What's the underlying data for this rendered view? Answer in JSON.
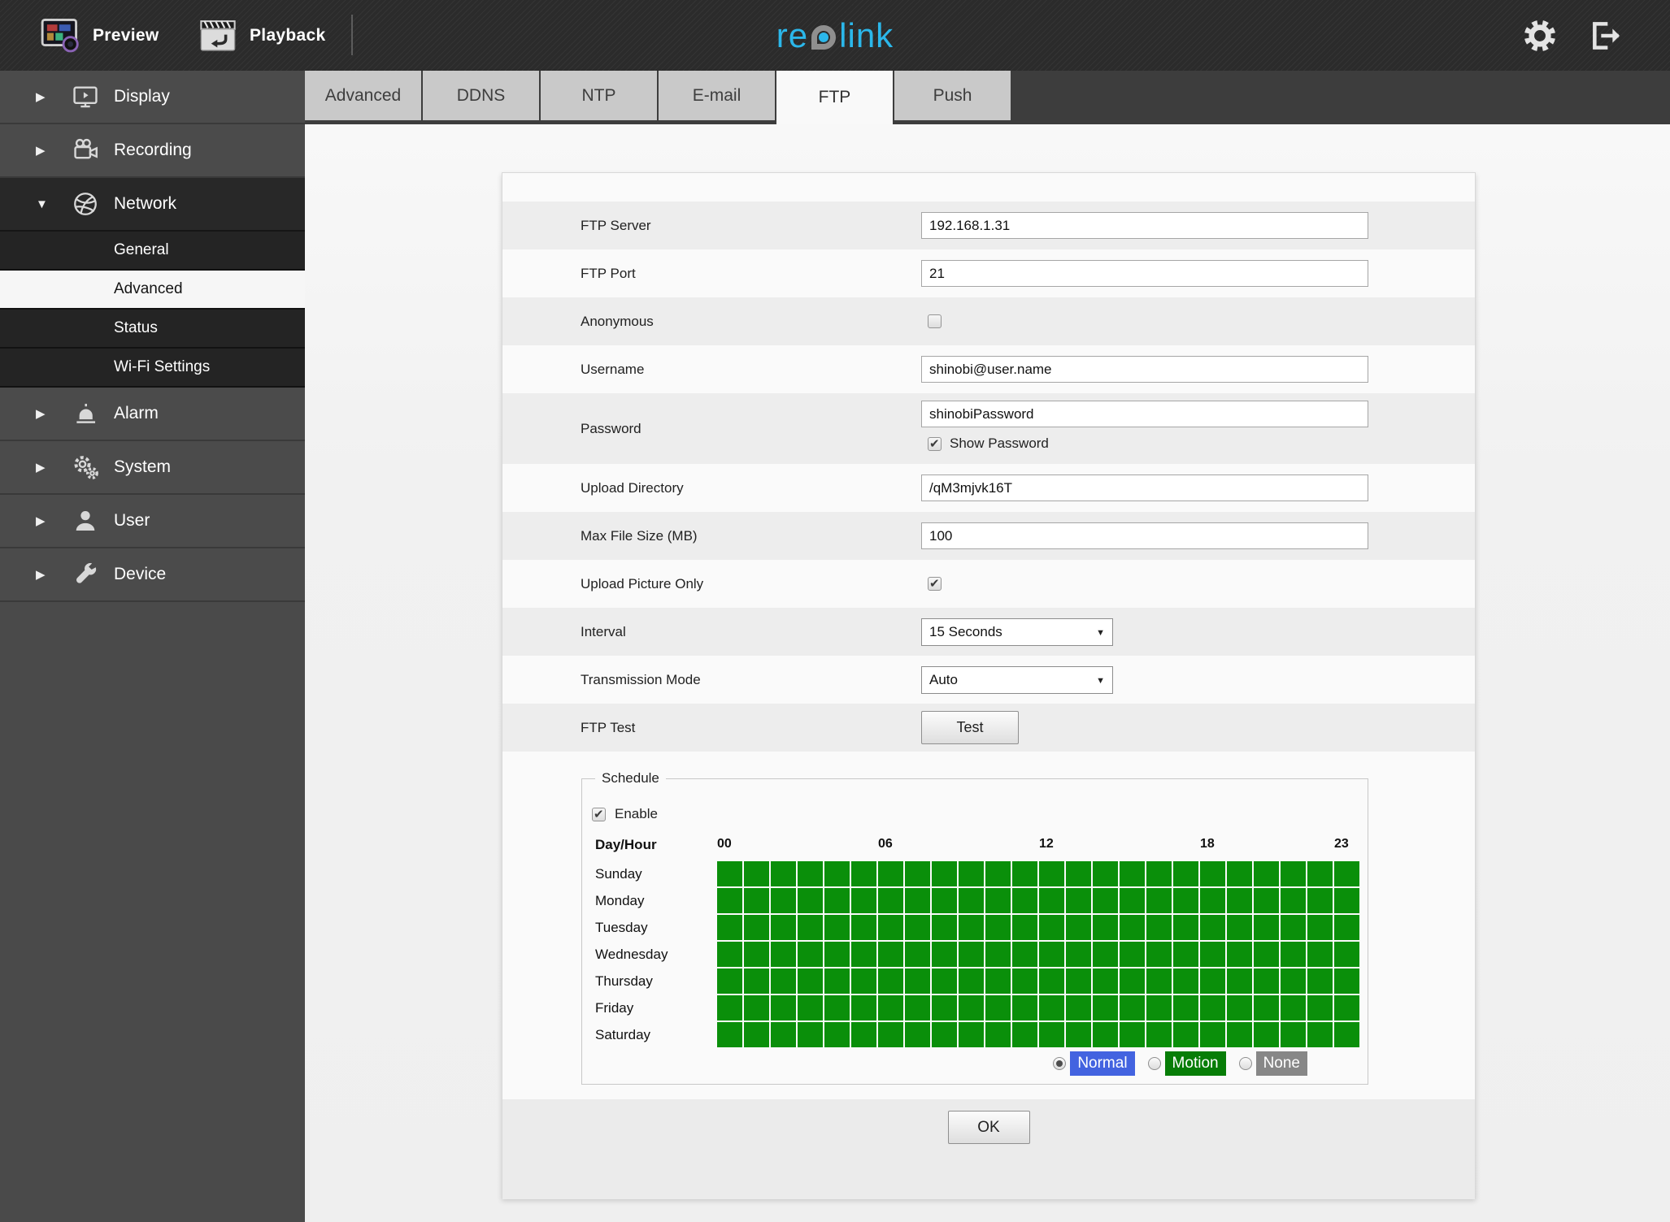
{
  "topbar": {
    "preview_label": "Preview",
    "playback_label": "Playback",
    "logo_re": "re",
    "logo_link": "link",
    "logo_color": "#2bb7ea",
    "logo_pin_gray": "#8f8f8f"
  },
  "sidebar": {
    "items": [
      {
        "label": "Display",
        "icon": "display",
        "expanded": false
      },
      {
        "label": "Recording",
        "icon": "recording",
        "expanded": false
      },
      {
        "label": "Network",
        "icon": "network",
        "expanded": true,
        "children": [
          {
            "label": "General",
            "active": false
          },
          {
            "label": "Advanced",
            "active": true
          },
          {
            "label": "Status",
            "active": false
          },
          {
            "label": "Wi-Fi Settings",
            "active": false
          }
        ]
      },
      {
        "label": "Alarm",
        "icon": "alarm",
        "expanded": false
      },
      {
        "label": "System",
        "icon": "system",
        "expanded": false
      },
      {
        "label": "User",
        "icon": "user",
        "expanded": false
      },
      {
        "label": "Device",
        "icon": "device",
        "expanded": false
      }
    ]
  },
  "tabs": {
    "items": [
      "Advanced",
      "DDNS",
      "NTP",
      "E-mail",
      "FTP",
      "Push"
    ],
    "active": "FTP"
  },
  "form": {
    "rows": [
      {
        "label": "FTP Server",
        "type": "text",
        "value": "192.168.1.31"
      },
      {
        "label": "FTP Port",
        "type": "text",
        "value": "21"
      },
      {
        "label": "Anonymous",
        "type": "checkbox",
        "checked": false
      },
      {
        "label": "Username",
        "type": "text",
        "value": "shinobi@user.name"
      },
      {
        "label": "Password",
        "type": "text",
        "value": "shinobiPassword",
        "extra": {
          "label": "Show Password",
          "checked": true
        }
      },
      {
        "label": "Upload Directory",
        "type": "text",
        "value": "/qM3mjvk16T"
      },
      {
        "label": "Max File Size (MB)",
        "type": "text",
        "value": "100"
      },
      {
        "label": "Upload Picture Only",
        "type": "checkbox",
        "checked": true
      },
      {
        "label": "Interval",
        "type": "select",
        "value": "15 Seconds"
      },
      {
        "label": "Transmission Mode",
        "type": "select",
        "value": "Auto"
      },
      {
        "label": "FTP Test",
        "type": "button",
        "value": "Test"
      }
    ]
  },
  "schedule": {
    "legend": "Schedule",
    "enable": {
      "label": "Enable",
      "checked": true
    },
    "day_hour_label": "Day/Hour",
    "hour_labels": [
      {
        "text": "00",
        "col": 0
      },
      {
        "text": "06",
        "col": 6
      },
      {
        "text": "12",
        "col": 12
      },
      {
        "text": "18",
        "col": 18
      },
      {
        "text": "23",
        "col": 23
      }
    ],
    "days": [
      "Sunday",
      "Monday",
      "Tuesday",
      "Wednesday",
      "Thursday",
      "Friday",
      "Saturday"
    ],
    "grid": {
      "rows": 7,
      "cols": 24,
      "all_filled": true,
      "cell_color": "#0a8f0a"
    },
    "modes": [
      {
        "label": "Normal",
        "color": "#4363e0",
        "selected": true
      },
      {
        "label": "Motion",
        "color": "#077d07",
        "selected": false
      },
      {
        "label": "None",
        "color": "#878787",
        "selected": false
      }
    ]
  },
  "footer": {
    "ok_label": "OK"
  }
}
